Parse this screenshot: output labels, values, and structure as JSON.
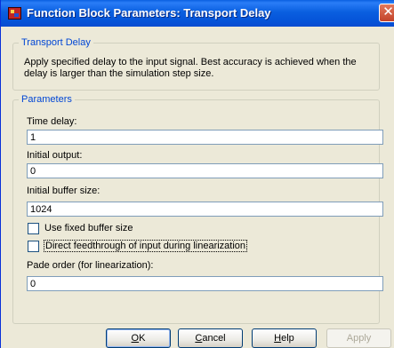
{
  "window": {
    "title": "Function Block Parameters: Transport Delay",
    "close_glyph": "✕"
  },
  "block_group": {
    "legend": "Transport Delay",
    "description": "Apply specified delay to the input signal.  Best accuracy is achieved when the delay is larger than the simulation step size."
  },
  "params_group": {
    "legend": "Parameters",
    "time_delay": {
      "label": "Time delay:",
      "value": "1"
    },
    "initial_output": {
      "label": "Initial output:",
      "value": "0"
    },
    "initial_buffer_size": {
      "label": "Initial buffer size:",
      "value": "1024"
    },
    "use_fixed_buffer": {
      "label": "Use fixed buffer size",
      "checked": false
    },
    "direct_feedthrough": {
      "label": "Direct feedthrough of input during linearization",
      "checked": false
    },
    "pade_order": {
      "label": "Pade order (for linearization):",
      "value": "0"
    }
  },
  "buttons": {
    "ok": {
      "mnemonic": "O",
      "rest": "K"
    },
    "cancel": {
      "mnemonic": "C",
      "rest": "ancel"
    },
    "help": {
      "mnemonic": "H",
      "rest": "elp"
    },
    "apply": {
      "label": "Apply",
      "enabled": false
    }
  },
  "icons": {
    "app": "simulink-block-icon",
    "close": "close-icon"
  }
}
